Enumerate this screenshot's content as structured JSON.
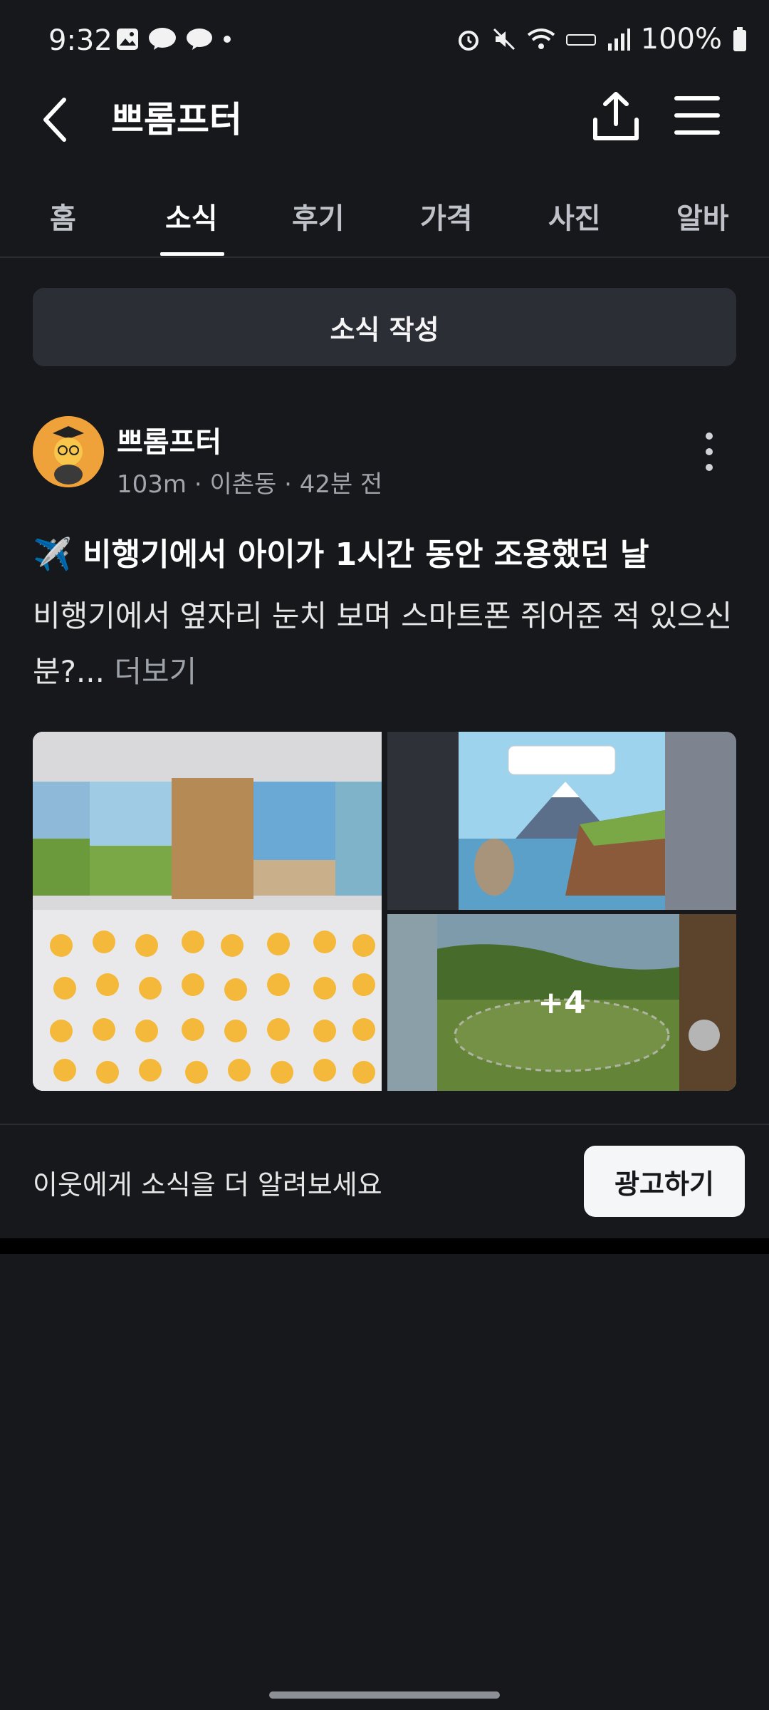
{
  "status_bar": {
    "time": "9:32",
    "battery": "100%"
  },
  "header": {
    "title": "쁘롬프터"
  },
  "tabs": [
    {
      "label": "홈"
    },
    {
      "label": "소식",
      "active": true
    },
    {
      "label": "후기"
    },
    {
      "label": "가격"
    },
    {
      "label": "사진"
    },
    {
      "label": "알바"
    }
  ],
  "compose_button": "소식 작성",
  "post": {
    "author": "쁘롬프터",
    "meta": "103m · 이촌동 · 42분 전",
    "title": "✈️ 비행기에서 아이가 1시간 동안 조용했던 날",
    "body": "비행기에서 옆자리 눈치 보며 스마트폰 쥐어준 적 있으신 분?...",
    "more_link": "더보기",
    "extra_images_label": "+4"
  },
  "promo": {
    "text": "이웃에게 소식을 더 알려보세요",
    "button": "광고하기"
  },
  "colors": {
    "background": "#17181c",
    "surface": "#2b2e35",
    "muted": "#a1a5ab"
  }
}
